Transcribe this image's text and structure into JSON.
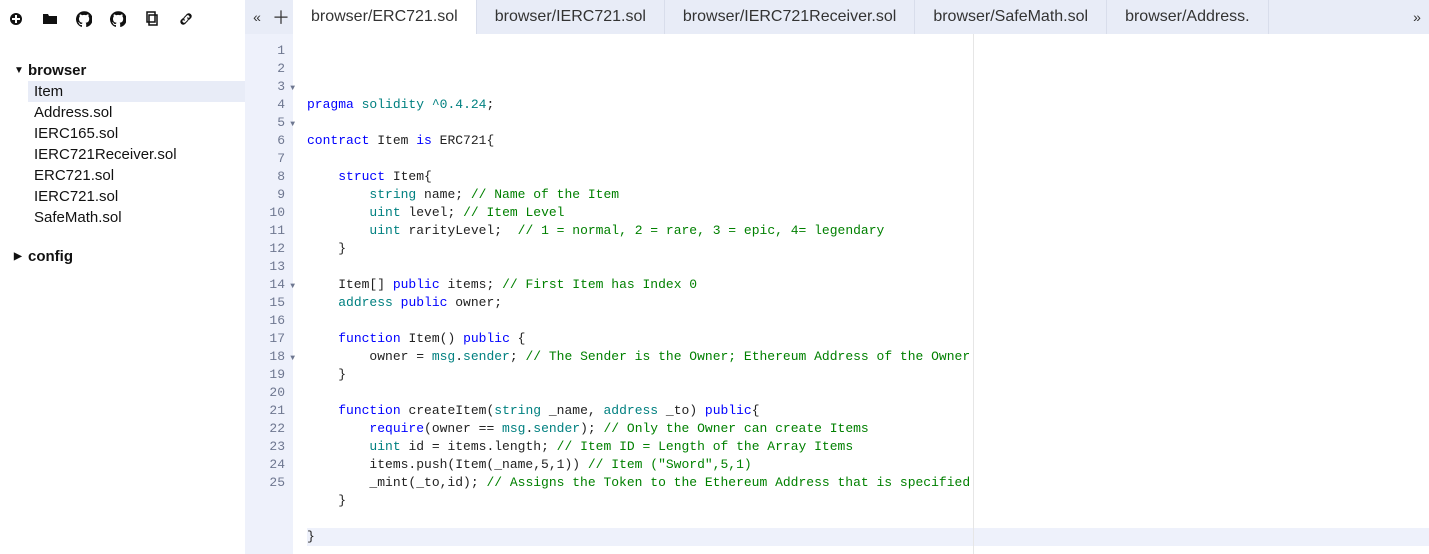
{
  "sidebar": {
    "folders": [
      {
        "name": "browser",
        "expanded": true,
        "items": [
          "Item",
          "Address.sol",
          "IERC165.sol",
          "IERC721Receiver.sol",
          "ERC721.sol",
          "IERC721.sol",
          "SafeMath.sol"
        ],
        "selected": "Item"
      },
      {
        "name": "config",
        "expanded": false,
        "items": []
      }
    ]
  },
  "tabs": {
    "items": [
      "browser/ERC721.sol",
      "browser/IERC721.sol",
      "browser/IERC721Receiver.sol",
      "browser/SafeMath.sol",
      "browser/Address."
    ],
    "active": 0
  },
  "editor": {
    "fold_lines": [
      3,
      5,
      14,
      18
    ],
    "cursor_line": 25,
    "lines": [
      [
        {
          "c": "kw",
          "t": "pragma"
        },
        {
          "c": "plain",
          "t": " "
        },
        {
          "c": "ty",
          "t": "solidity"
        },
        {
          "c": "plain",
          "t": " "
        },
        {
          "c": "str",
          "t": "^0.4.24"
        },
        {
          "c": "plain",
          "t": ";"
        }
      ],
      [],
      [
        {
          "c": "kw",
          "t": "contract"
        },
        {
          "c": "plain",
          "t": " Item "
        },
        {
          "c": "kw",
          "t": "is"
        },
        {
          "c": "plain",
          "t": " ERC721{"
        }
      ],
      [],
      [
        {
          "c": "plain",
          "t": "    "
        },
        {
          "c": "kw",
          "t": "struct"
        },
        {
          "c": "plain",
          "t": " Item{"
        }
      ],
      [
        {
          "c": "plain",
          "t": "        "
        },
        {
          "c": "ty",
          "t": "string"
        },
        {
          "c": "plain",
          "t": " name; "
        },
        {
          "c": "cm",
          "t": "// Name of the Item"
        }
      ],
      [
        {
          "c": "plain",
          "t": "        "
        },
        {
          "c": "ty",
          "t": "uint"
        },
        {
          "c": "plain",
          "t": " level; "
        },
        {
          "c": "cm",
          "t": "// Item Level"
        }
      ],
      [
        {
          "c": "plain",
          "t": "        "
        },
        {
          "c": "ty",
          "t": "uint"
        },
        {
          "c": "plain",
          "t": " rarityLevel;  "
        },
        {
          "c": "cm",
          "t": "// 1 = normal, 2 = rare, 3 = epic, 4= legendary"
        }
      ],
      [
        {
          "c": "plain",
          "t": "    }"
        }
      ],
      [],
      [
        {
          "c": "plain",
          "t": "    Item[] "
        },
        {
          "c": "kw",
          "t": "public"
        },
        {
          "c": "plain",
          "t": " items; "
        },
        {
          "c": "cm",
          "t": "// First Item has Index 0"
        }
      ],
      [
        {
          "c": "plain",
          "t": "    "
        },
        {
          "c": "ty",
          "t": "address"
        },
        {
          "c": "plain",
          "t": " "
        },
        {
          "c": "kw",
          "t": "public"
        },
        {
          "c": "plain",
          "t": " owner;"
        }
      ],
      [],
      [
        {
          "c": "plain",
          "t": "    "
        },
        {
          "c": "kw",
          "t": "function"
        },
        {
          "c": "plain",
          "t": " Item() "
        },
        {
          "c": "kw",
          "t": "public"
        },
        {
          "c": "plain",
          "t": " {"
        }
      ],
      [
        {
          "c": "plain",
          "t": "        owner = "
        },
        {
          "c": "prop",
          "t": "msg"
        },
        {
          "c": "plain",
          "t": "."
        },
        {
          "c": "prop",
          "t": "sender"
        },
        {
          "c": "plain",
          "t": "; "
        },
        {
          "c": "cm",
          "t": "// The Sender is the Owner; Ethereum Address of the Owner"
        }
      ],
      [
        {
          "c": "plain",
          "t": "    }"
        }
      ],
      [],
      [
        {
          "c": "plain",
          "t": "    "
        },
        {
          "c": "kw",
          "t": "function"
        },
        {
          "c": "plain",
          "t": " createItem("
        },
        {
          "c": "ty",
          "t": "string"
        },
        {
          "c": "plain",
          "t": " _name, "
        },
        {
          "c": "ty",
          "t": "address"
        },
        {
          "c": "plain",
          "t": " _to) "
        },
        {
          "c": "kw",
          "t": "public"
        },
        {
          "c": "plain",
          "t": "{"
        }
      ],
      [
        {
          "c": "plain",
          "t": "        "
        },
        {
          "c": "fn",
          "t": "require"
        },
        {
          "c": "plain",
          "t": "(owner == "
        },
        {
          "c": "prop",
          "t": "msg"
        },
        {
          "c": "plain",
          "t": "."
        },
        {
          "c": "prop",
          "t": "sender"
        },
        {
          "c": "plain",
          "t": "); "
        },
        {
          "c": "cm",
          "t": "// Only the Owner can create Items"
        }
      ],
      [
        {
          "c": "plain",
          "t": "        "
        },
        {
          "c": "ty",
          "t": "uint"
        },
        {
          "c": "plain",
          "t": " id = items.length; "
        },
        {
          "c": "cm",
          "t": "// Item ID = Length of the Array Items"
        }
      ],
      [
        {
          "c": "plain",
          "t": "        items.push(Item(_name,5,1)) "
        },
        {
          "c": "cm",
          "t": "// Item (\"Sword\",5,1)"
        }
      ],
      [
        {
          "c": "plain",
          "t": "        _mint(_to,id); "
        },
        {
          "c": "cm",
          "t": "// Assigns the Token to the Ethereum Address that is specified"
        }
      ],
      [
        {
          "c": "plain",
          "t": "    }"
        }
      ],
      [],
      [
        {
          "c": "plain",
          "t": "}"
        }
      ]
    ]
  }
}
